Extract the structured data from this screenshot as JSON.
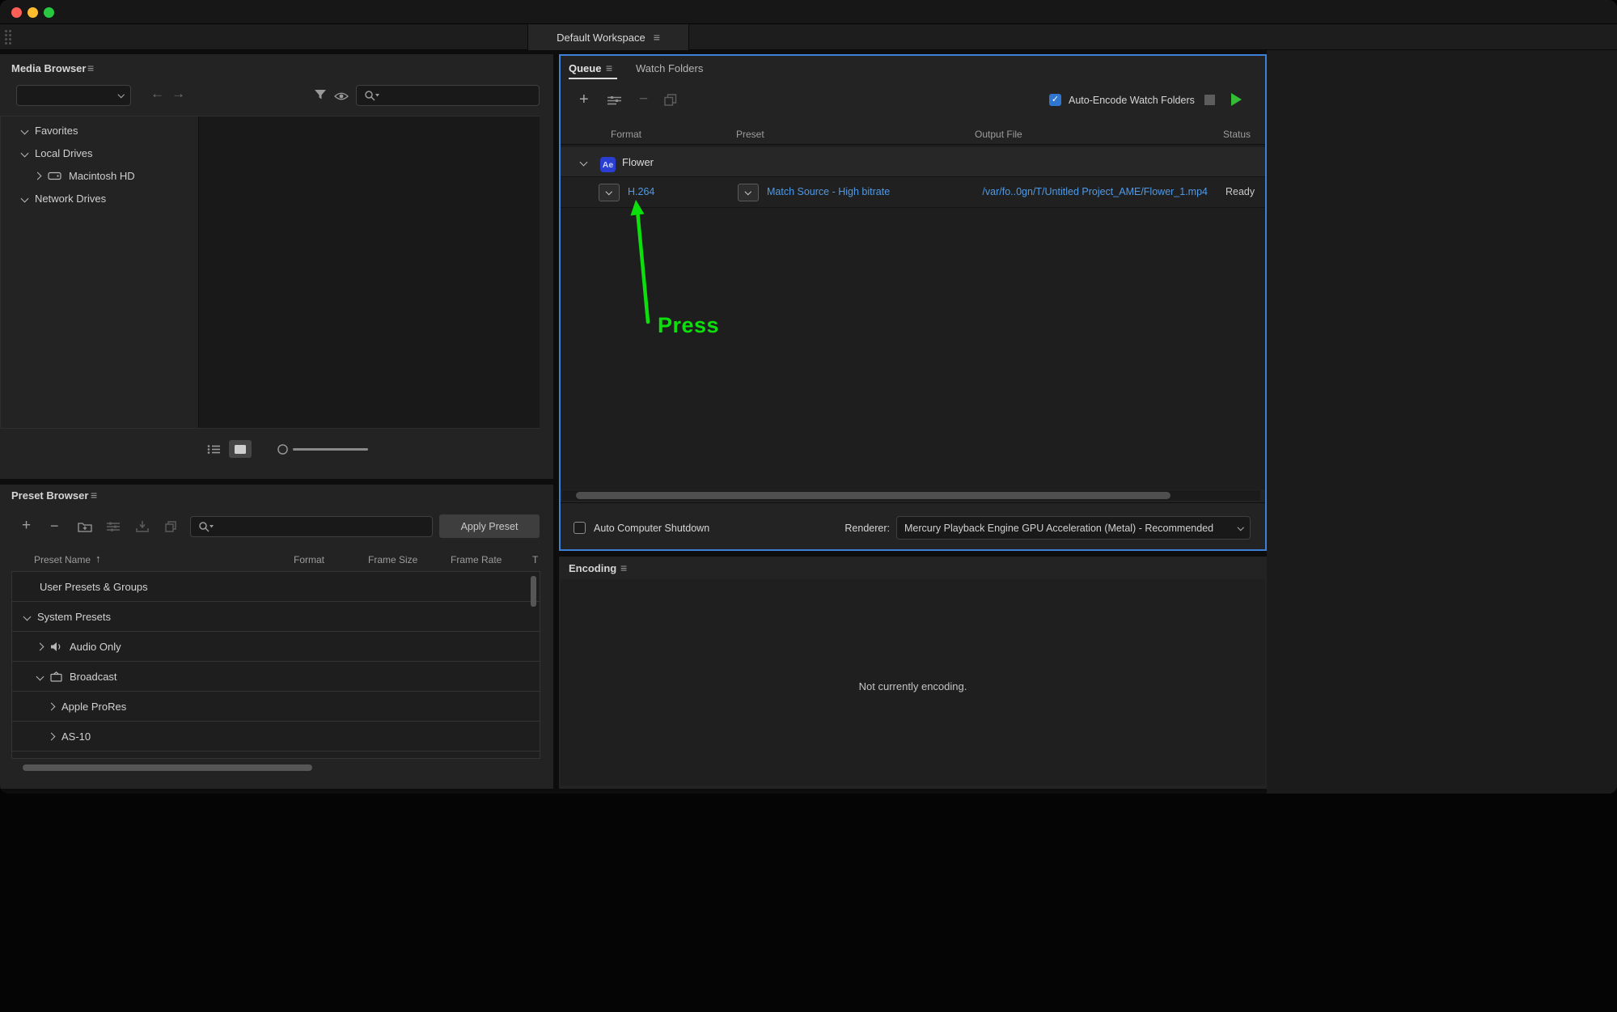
{
  "workspace_tab": {
    "label": "Default Workspace"
  },
  "icons": {
    "panel_menu": "≡",
    "back": "←",
    "forward": "→",
    "sort_up": "↑",
    "plus": "+",
    "minus": "−",
    "check": "✓"
  },
  "media_browser": {
    "title": "Media Browser",
    "tree": {
      "favorites": "Favorites",
      "local_drives": "Local Drives",
      "macintosh_hd": "Macintosh HD",
      "network_drives": "Network Drives"
    }
  },
  "preset_browser": {
    "title": "Preset Browser",
    "apply_button": "Apply Preset",
    "columns": {
      "name": "Preset Name",
      "format": "Format",
      "frame_size": "Frame Size",
      "frame_rate": "Frame Rate",
      "type": "T"
    },
    "rows": [
      {
        "label": "User Presets & Groups"
      },
      {
        "label": "System Presets"
      },
      {
        "label": "Audio Only"
      },
      {
        "label": "Broadcast"
      },
      {
        "label": "Apple ProRes"
      },
      {
        "label": "AS-10"
      }
    ]
  },
  "queue": {
    "tab_queue": "Queue",
    "tab_watch_folders": "Watch Folders",
    "auto_encode_label": "Auto-Encode Watch Folders",
    "auto_encode_checked": true,
    "columns": {
      "format": "Format",
      "preset": "Preset",
      "output_file": "Output File",
      "status": "Status"
    },
    "group": {
      "badge": "Ae",
      "name": "Flower"
    },
    "item": {
      "format": "H.264",
      "preset": "Match Source - High bitrate",
      "output_file": "/var/fo..0gn/T/Untitled Project_AME/Flower_1.mp4",
      "status": "Ready"
    },
    "auto_shutdown_label": "Auto Computer Shutdown",
    "auto_shutdown_checked": false,
    "renderer_label": "Renderer:",
    "renderer_value": "Mercury Playback Engine GPU Acceleration (Metal) - Recommended"
  },
  "encoding": {
    "title": "Encoding",
    "message": "Not currently encoding."
  },
  "annotation": {
    "label": "Press",
    "color": "#0cdf0c"
  },
  "colors": {
    "focus_border_blue": "#3c80d8",
    "link_blue": "#4f9ae8",
    "checkbox_blue": "#2e76cf",
    "play_green": "#36bd36",
    "annotation_green": "#0cdf0c",
    "panel_bg": "#232323"
  }
}
